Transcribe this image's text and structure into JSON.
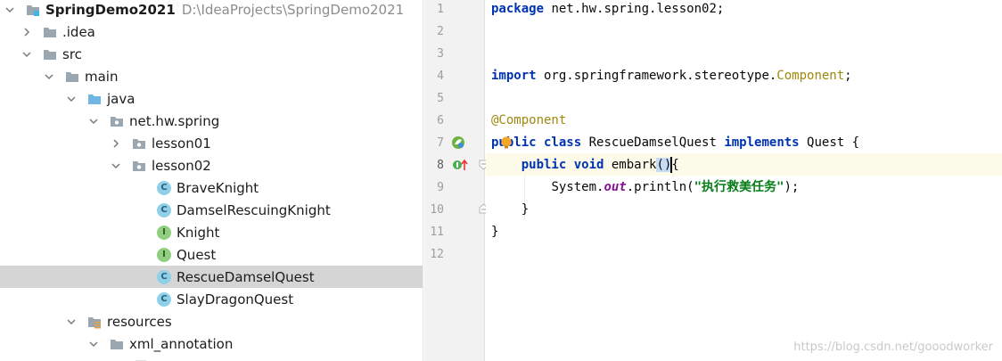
{
  "project_tree": {
    "root": {
      "label": "SpringDemo2021",
      "path": "D:\\IdeaProjects\\SpringDemo2021"
    },
    "items": [
      {
        "label": ".idea",
        "icon": "folder-icon",
        "expanded": false
      },
      {
        "label": "src",
        "icon": "folder-icon",
        "expanded": true
      },
      {
        "label": "main",
        "icon": "folder-icon",
        "expanded": true
      },
      {
        "label": "java",
        "icon": "source-folder-icon",
        "expanded": true
      },
      {
        "label": "net.hw.spring",
        "icon": "package-icon",
        "expanded": true
      },
      {
        "label": "lesson01",
        "icon": "package-icon",
        "expanded": false
      },
      {
        "label": "lesson02",
        "icon": "package-icon",
        "expanded": true
      },
      {
        "label": "BraveKnight",
        "icon": "class-icon",
        "badge": "C"
      },
      {
        "label": "DamselRescuingKnight",
        "icon": "class-icon",
        "badge": "C"
      },
      {
        "label": "Knight",
        "icon": "interface-icon",
        "badge": "I"
      },
      {
        "label": "Quest",
        "icon": "interface-icon",
        "badge": "I"
      },
      {
        "label": "RescueDamselQuest",
        "icon": "class-icon",
        "badge": "C",
        "selected": true
      },
      {
        "label": "SlayDragonQuest",
        "icon": "class-icon",
        "badge": "C"
      },
      {
        "label": "resources",
        "icon": "resources-folder-icon",
        "expanded": true
      },
      {
        "label": "xml_annotation",
        "icon": "folder-icon",
        "expanded": true
      }
    ]
  },
  "editor": {
    "line_numbers": [
      "1",
      "2",
      "3",
      "4",
      "5",
      "6",
      "7",
      "8",
      "9",
      "10",
      "11",
      "12"
    ],
    "lines": {
      "l1": {
        "kw": "package",
        "rest": " net.hw.spring.lesson02;"
      },
      "l4": {
        "kw": "import",
        "rest": " org.springframework.stereotype.",
        "ann": "Component",
        "end": ";"
      },
      "l6": {
        "ann": "@Component"
      },
      "l7": {
        "kw1": "public class",
        "name": " RescueDamselQuest ",
        "kw2": "implements",
        "rest": " Quest {"
      },
      "l8": {
        "indent": "    ",
        "kw": "public void",
        "name": " embark",
        "paren": "()",
        "rest": "{"
      },
      "l9": {
        "indent": "        ",
        "obj": "System.",
        "field": "out",
        "call": ".println(",
        "str": "\"执行救美任务\"",
        "end": ");"
      },
      "l10": {
        "text": "    }"
      },
      "l11": {
        "text": "}"
      }
    },
    "caret_line": 8
  },
  "watermark": "https://blog.csdn.net/gooodworker",
  "colors": {
    "keyword": "#0033b3",
    "annotation": "#9e880d",
    "string": "#067d17",
    "static_field": "#871094",
    "selection": "#d5d5d5",
    "caret_line": "#fcfae8"
  }
}
